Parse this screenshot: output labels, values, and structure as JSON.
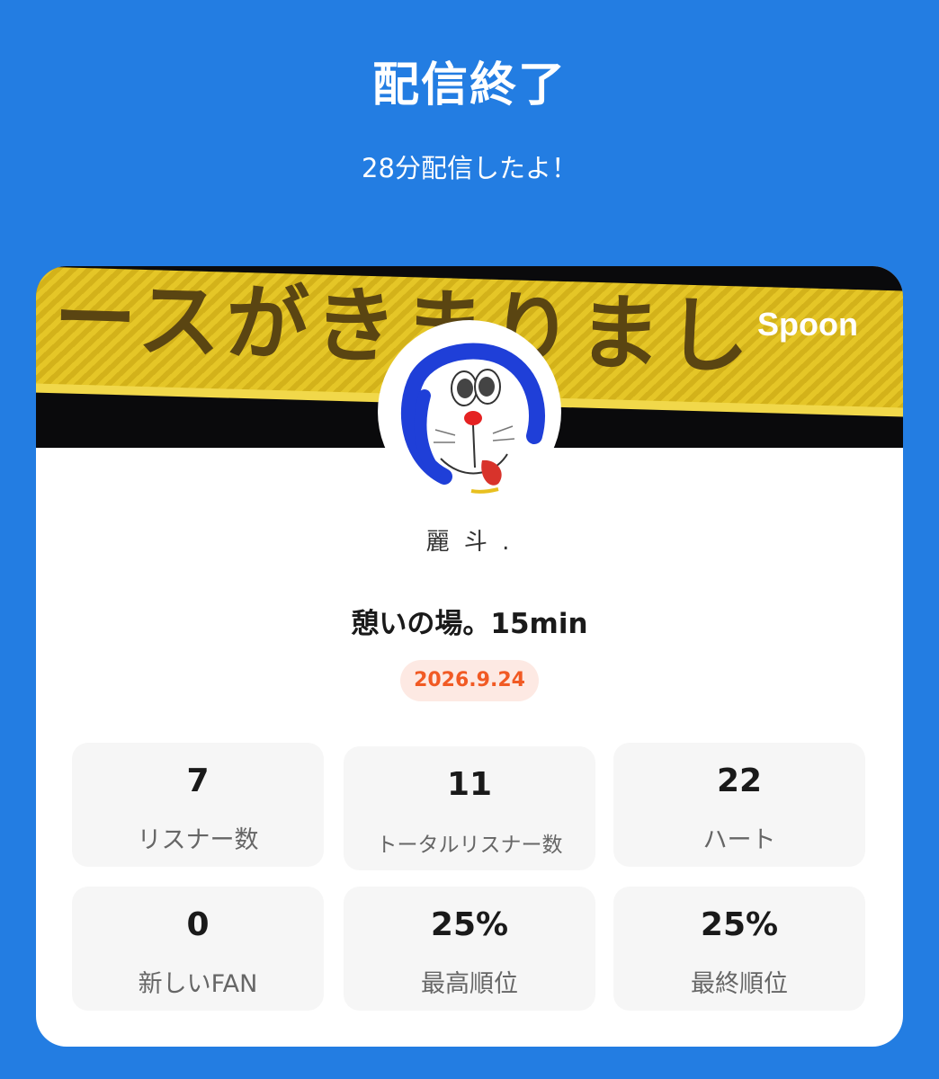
{
  "header": {
    "title": "配信終了",
    "subtitle": "28分配信したよ！"
  },
  "card": {
    "brand": "Spoon",
    "banner_text": "ースがきまりまし",
    "nickname": "麗 斗 .",
    "live_title": "憩いの場。15min",
    "date": "2026.9.24"
  },
  "stats": [
    {
      "value": "7",
      "label": "リスナー数"
    },
    {
      "value": "11",
      "label": "トータルリスナー数"
    },
    {
      "value": "22",
      "label": "ハート"
    },
    {
      "value": "0",
      "label": "新しいFAN"
    },
    {
      "value": "25%",
      "label": "最高順位"
    },
    {
      "value": "25%",
      "label": "最終順位"
    }
  ],
  "colors": {
    "background": "#237de2",
    "date_badge_text": "#f15a24",
    "date_badge_bg": "#fde9e3"
  },
  "icons": [
    "avatar-character-image",
    "banner-image"
  ]
}
